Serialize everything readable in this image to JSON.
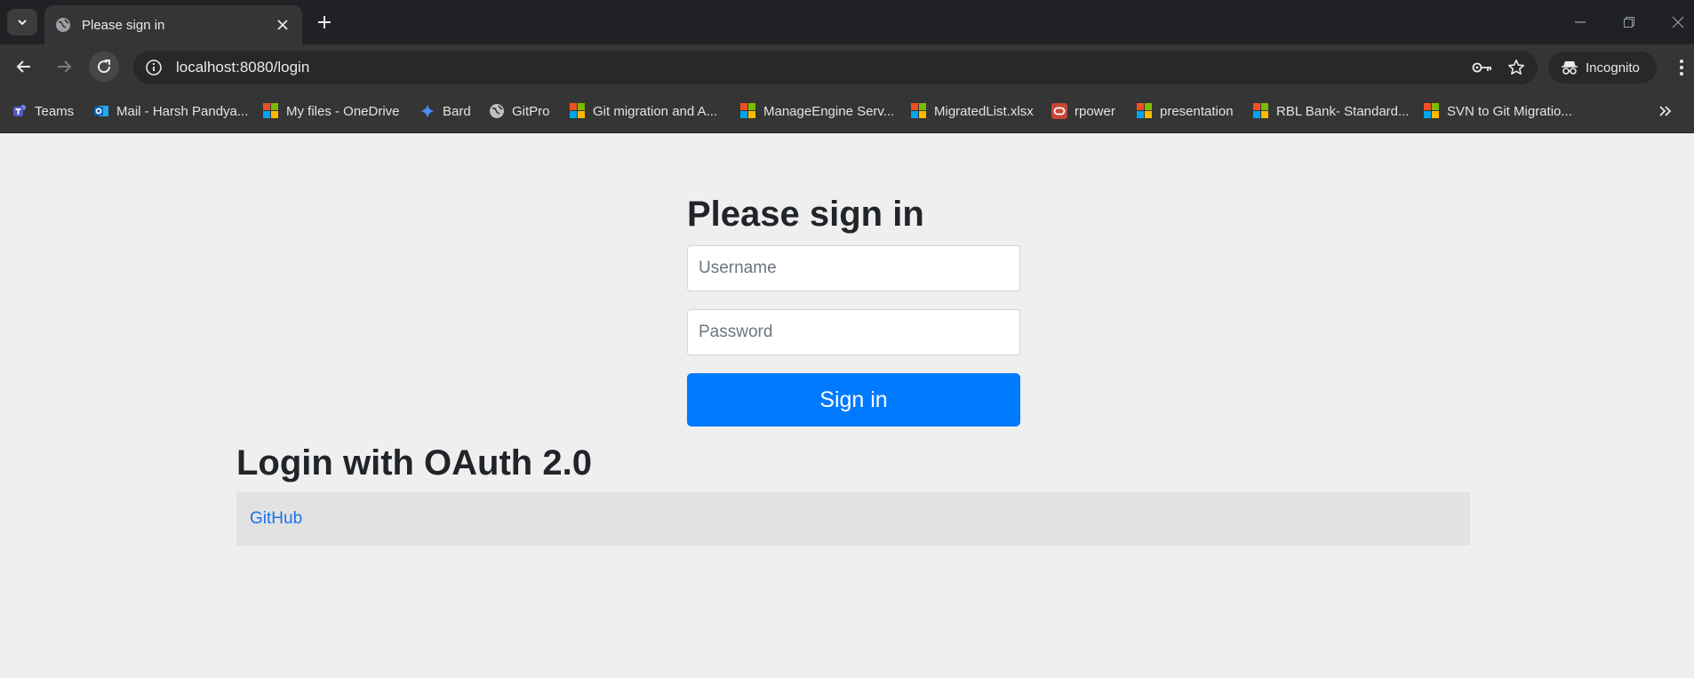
{
  "browser": {
    "tab": {
      "title": "Please sign in"
    },
    "address_bar": {
      "url": "localhost:8080/login"
    },
    "incognito_label": "Incognito",
    "bookmarks": [
      {
        "label": "Teams",
        "icon": "teams-icon"
      },
      {
        "label": "Mail - Harsh Pandya...",
        "icon": "outlook-icon"
      },
      {
        "label": "My files - OneDrive",
        "icon": "microsoft-icon"
      },
      {
        "label": "Bard",
        "icon": "bard-sparkle-icon"
      },
      {
        "label": "GitPro",
        "icon": "globe-icon"
      },
      {
        "label": "Git migration and A...",
        "icon": "microsoft-icon"
      },
      {
        "label": "ManageEngine Serv...",
        "icon": "microsoft-icon"
      },
      {
        "label": "MigratedList.xlsx",
        "icon": "microsoft-icon"
      },
      {
        "label": "rpower",
        "icon": "oracle-icon"
      },
      {
        "label": "presentation",
        "icon": "microsoft-icon"
      },
      {
        "label": "RBL Bank- Standard...",
        "icon": "microsoft-icon"
      },
      {
        "label": "SVN to Git Migratio...",
        "icon": "microsoft-icon"
      }
    ]
  },
  "login": {
    "title": "Please sign in",
    "username_placeholder": "Username",
    "password_placeholder": "Password",
    "submit_label": "Sign in"
  },
  "oauth": {
    "title": "Login with OAuth 2.0",
    "providers": [
      {
        "label": "GitHub"
      }
    ]
  },
  "colors": {
    "primary": "#007bff",
    "link": "#1a73e8",
    "page_bg": "#efefef"
  }
}
